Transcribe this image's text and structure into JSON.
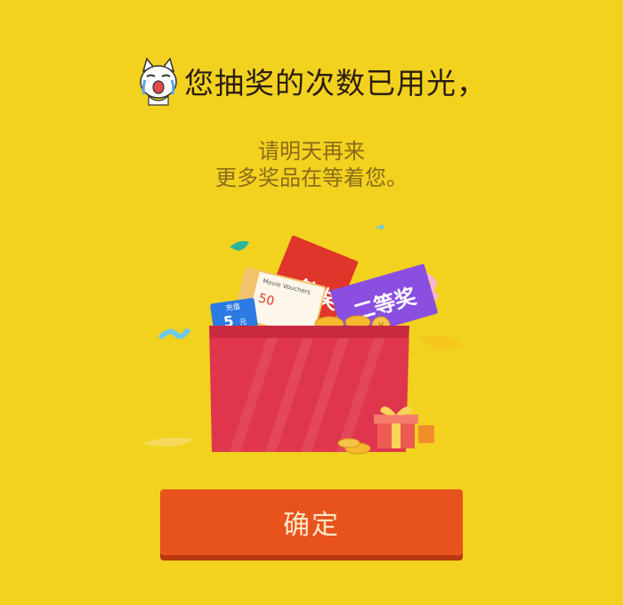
{
  "dialog": {
    "title": "您抽奖的次数已用光，",
    "subtitle_line1": "请明天再来",
    "subtitle_line2": "更多奖品在等着您。"
  },
  "illustration": {
    "prize_card_1": "一等奖",
    "prize_card_2": "二等奖",
    "voucher_title": "Movie Vouchers",
    "voucher_amount": "50",
    "recharge_label": "充值",
    "recharge_amount": "5",
    "recharge_unit": "元",
    "coin_symbol": "¥",
    "icons": [
      "crying-cat-icon",
      "gift-box-icon",
      "coin-icon"
    ]
  },
  "actions": {
    "confirm_label": "确定"
  },
  "colors": {
    "background": "#f2d21f",
    "button": "#e8521d",
    "button_text": "#ffe9c9",
    "box": "#e0364d",
    "title_text": "#2b1d12",
    "subtitle_text": "#8a6b1c"
  }
}
